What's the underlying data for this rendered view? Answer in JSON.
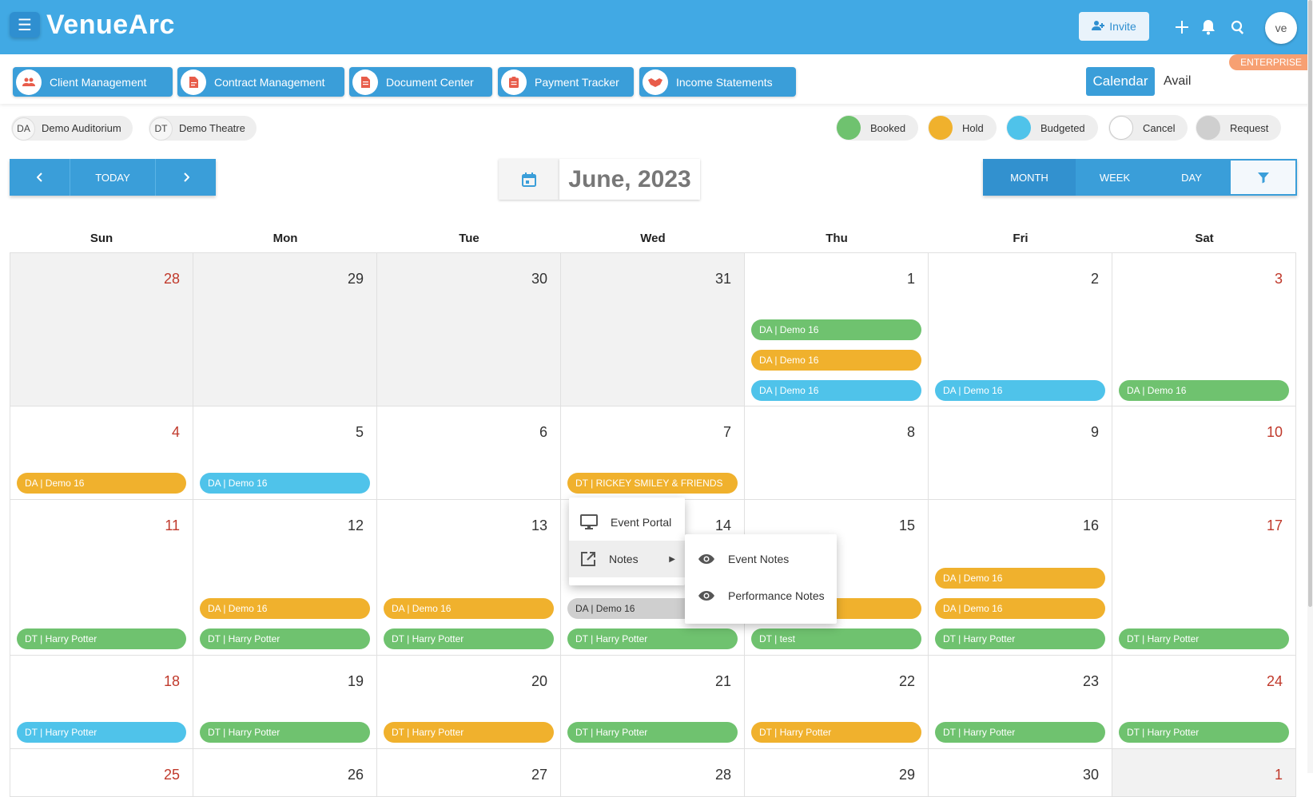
{
  "header": {
    "logo": "VenueArc",
    "invite_label": "Invite",
    "avatar_initials": "ve",
    "plan_badge": "ENTERPRISE"
  },
  "nav": {
    "tabs": [
      {
        "label": "Client Management"
      },
      {
        "label": "Contract Management"
      },
      {
        "label": "Document Center"
      },
      {
        "label": "Payment Tracker"
      },
      {
        "label": "Income Statements"
      }
    ],
    "view_toggle": {
      "calendar": "Calendar",
      "avail": "Avail"
    }
  },
  "venues": [
    {
      "initials": "DA",
      "name": "Demo Auditorium"
    },
    {
      "initials": "DT",
      "name": "Demo Theatre"
    }
  ],
  "legend": [
    {
      "label": "Booked",
      "color": "#6fc26f"
    },
    {
      "label": "Hold",
      "color": "#f0b12d"
    },
    {
      "label": "Budgeted",
      "color": "#4fc3ea"
    },
    {
      "label": "Cancel",
      "color": "#ffffff"
    },
    {
      "label": "Request",
      "color": "#cfcfcf"
    }
  ],
  "toolbar": {
    "prev_icon": "chevron-left-icon",
    "today_label": "TODAY",
    "next_icon": "chevron-right-icon",
    "month_title": "June, 2023",
    "views": [
      "MONTH",
      "WEEK",
      "DAY"
    ]
  },
  "days_of_week": [
    "Sun",
    "Mon",
    "Tue",
    "Wed",
    "Thu",
    "Fri",
    "Sat"
  ],
  "calendar": {
    "weeks": [
      [
        {
          "day": "28",
          "out": true,
          "events": []
        },
        {
          "day": "29",
          "out": true,
          "events": []
        },
        {
          "day": "30",
          "out": true,
          "events": []
        },
        {
          "day": "31",
          "out": true,
          "events": []
        },
        {
          "day": "1",
          "events": [
            {
              "slot": 2,
              "label": "DA | Demo 16",
              "status": "booked"
            },
            {
              "slot": 1,
              "label": "DA | Demo 16",
              "status": "hold"
            },
            {
              "slot": 0,
              "label": "DA | Demo 16",
              "status": "budgeted"
            }
          ]
        },
        {
          "day": "2",
          "events": [
            {
              "slot": 0,
              "label": "DA | Demo 16",
              "status": "budgeted"
            }
          ]
        },
        {
          "day": "3",
          "events": [
            {
              "slot": 0,
              "label": "DA | Demo 16",
              "status": "booked"
            }
          ]
        }
      ],
      [
        {
          "day": "4",
          "events": [
            {
              "slot": 0,
              "label": "DA | Demo 16",
              "status": "hold"
            }
          ]
        },
        {
          "day": "5",
          "events": [
            {
              "slot": 0,
              "label": "DA | Demo 16",
              "status": "budgeted"
            }
          ]
        },
        {
          "day": "6",
          "events": []
        },
        {
          "day": "7",
          "events": [
            {
              "slot": 0,
              "label": "DT | RICKEY SMILEY & FRIENDS",
              "status": "hold"
            }
          ]
        },
        {
          "day": "8",
          "events": []
        },
        {
          "day": "9",
          "events": []
        },
        {
          "day": "10",
          "events": []
        }
      ],
      [
        {
          "day": "11",
          "events": [
            {
              "slot": 0,
              "label": "DT | Harry Potter",
              "status": "booked"
            }
          ]
        },
        {
          "day": "12",
          "events": [
            {
              "slot": 1,
              "label": "DA | Demo 16",
              "status": "hold"
            },
            {
              "slot": 0,
              "label": "DT | Harry Potter",
              "status": "booked"
            }
          ]
        },
        {
          "day": "13",
          "events": [
            {
              "slot": 1,
              "label": "DA | Demo 16",
              "status": "hold"
            },
            {
              "slot": 0,
              "label": "DT | Harry Potter",
              "status": "booked"
            }
          ]
        },
        {
          "day": "14",
          "events": [
            {
              "slot": 1,
              "label": "DA | Demo 16",
              "status": "request"
            },
            {
              "slot": 0,
              "label": "DT | Harry Potter",
              "status": "booked"
            }
          ]
        },
        {
          "day": "15",
          "events": [
            {
              "slot": 1,
              "label": "",
              "status": "hold"
            },
            {
              "slot": 0,
              "label": "DT | test",
              "status": "booked"
            }
          ]
        },
        {
          "day": "16",
          "events": [
            {
              "slot": 2,
              "label": "DA | Demo 16",
              "status": "hold"
            },
            {
              "slot": 1,
              "label": "DA | Demo 16",
              "status": "hold"
            },
            {
              "slot": 0,
              "label": "DT | Harry Potter",
              "status": "booked"
            }
          ]
        },
        {
          "day": "17",
          "events": [
            {
              "slot": 0,
              "label": "DT | Harry Potter",
              "status": "booked"
            }
          ]
        }
      ],
      [
        {
          "day": "18",
          "events": [
            {
              "slot": 0,
              "label": "DT | Harry Potter",
              "status": "budgeted"
            }
          ]
        },
        {
          "day": "19",
          "events": [
            {
              "slot": 0,
              "label": "DT | Harry Potter",
              "status": "booked"
            }
          ]
        },
        {
          "day": "20",
          "events": [
            {
              "slot": 0,
              "label": "DT | Harry Potter",
              "status": "hold"
            }
          ]
        },
        {
          "day": "21",
          "events": [
            {
              "slot": 0,
              "label": "DT | Harry Potter",
              "status": "booked"
            }
          ]
        },
        {
          "day": "22",
          "events": [
            {
              "slot": 0,
              "label": "DT | Harry Potter",
              "status": "hold"
            }
          ]
        },
        {
          "day": "23",
          "events": [
            {
              "slot": 0,
              "label": "DT | Harry Potter",
              "status": "booked"
            }
          ]
        },
        {
          "day": "24",
          "events": [
            {
              "slot": 0,
              "label": "DT | Harry Potter",
              "status": "booked"
            }
          ]
        }
      ],
      [
        {
          "day": "25",
          "events": []
        },
        {
          "day": "26",
          "events": []
        },
        {
          "day": "27",
          "events": []
        },
        {
          "day": "28",
          "events": []
        },
        {
          "day": "29",
          "events": []
        },
        {
          "day": "30",
          "events": []
        },
        {
          "day": "1",
          "out": true,
          "events": []
        }
      ]
    ]
  },
  "context_menu": {
    "items": [
      {
        "label": "Event Portal",
        "icon": "monitor-icon"
      },
      {
        "label": "Notes",
        "icon": "external-link-icon",
        "has_submenu": true
      }
    ],
    "submenu": [
      {
        "label": "Event Notes",
        "icon": "eye-icon"
      },
      {
        "label": "Performance Notes",
        "icon": "eye-icon"
      }
    ]
  }
}
